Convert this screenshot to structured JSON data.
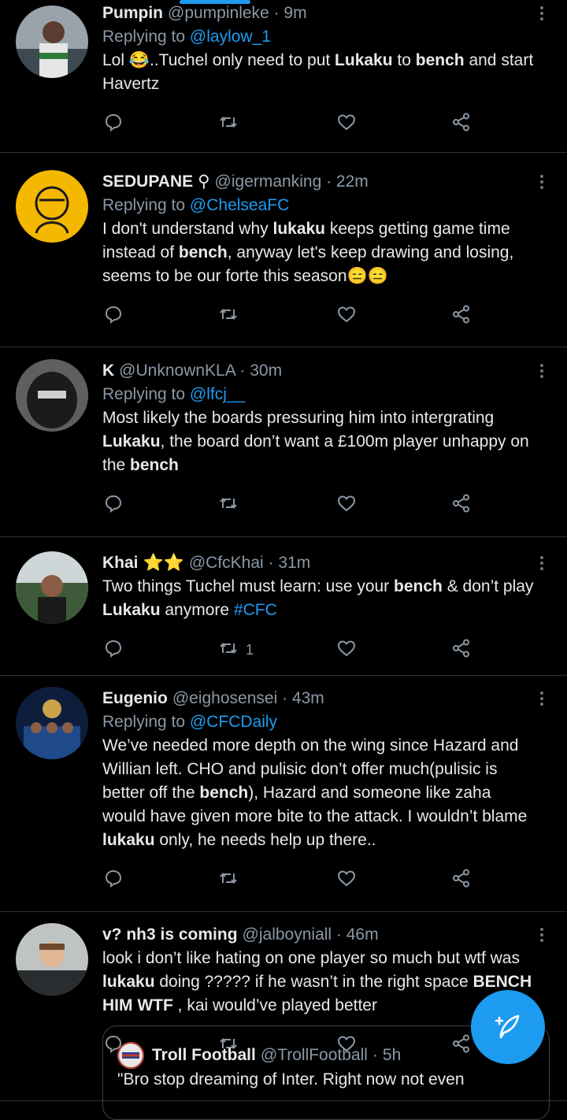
{
  "tweets": [
    {
      "name": "Pumpin",
      "handle": "@pumpinleke",
      "time": "9m",
      "reply_prefix": "Replying to",
      "reply_to": "@laylow_1",
      "text_parts": [
        {
          "t": "Lol 😂..Tuchel only need to put "
        },
        {
          "t": "Lukaku",
          "b": true
        },
        {
          "t": " to "
        },
        {
          "t": "bench",
          "b": true
        },
        {
          "t": " and start Havertz"
        }
      ],
      "retweets": "",
      "avatar_color": "#7a8590"
    },
    {
      "name": "SEDUPANE",
      "badge": "⚲",
      "handle": "@igermanking",
      "time": "22m",
      "reply_prefix": "Replying to",
      "reply_to": "@ChelseaFC",
      "text_parts": [
        {
          "t": "I don't understand why "
        },
        {
          "t": "lukaku",
          "b": true
        },
        {
          "t": " keeps getting game time instead of "
        },
        {
          "t": "bench",
          "b": true
        },
        {
          "t": ", anyway let's keep drawing and losing, seems to be our forte this season😑😑"
        }
      ],
      "retweets": "",
      "avatar_color": "#f5b800"
    },
    {
      "name": "K",
      "handle": "@UnknownKLA",
      "time": "30m",
      "reply_prefix": "Replying to",
      "reply_to": "@lfcj__",
      "text_parts": [
        {
          "t": "Most likely the boards pressuring him into intergrating "
        },
        {
          "t": "Lukaku",
          "b": true
        },
        {
          "t": ", the board don’t want a £100m player unhappy on the "
        },
        {
          "t": "bench",
          "b": true
        }
      ],
      "retweets": "",
      "avatar_color": "#2a2a2a"
    },
    {
      "name": "Khai",
      "badge": "⭐⭐",
      "handle": "@CfcKhai",
      "time": "31m",
      "reply_prefix": "",
      "reply_to": "",
      "text_parts": [
        {
          "t": "Two things Tuchel must learn: use your "
        },
        {
          "t": "bench",
          "b": true
        },
        {
          "t": " & don’t play "
        },
        {
          "t": "Lukaku",
          "b": true
        },
        {
          "t": " anymore "
        },
        {
          "t": "#CFC",
          "tag": true
        }
      ],
      "retweets": "1",
      "avatar_color": "#4a5a48"
    },
    {
      "name": "Eugenio",
      "handle": "@eighosensei",
      "time": "43m",
      "reply_prefix": "Replying to",
      "reply_to": "@CFCDaily",
      "text_parts": [
        {
          "t": "We’ve needed more depth on the wing since Hazard and Willian left. CHO and pulisic don’t offer much(pulisic is better off the "
        },
        {
          "t": "bench",
          "b": true
        },
        {
          "t": "), Hazard and someone like zaha would have given more bite to the attack. I wouldn’t blame "
        },
        {
          "t": "lukaku",
          "b": true
        },
        {
          "t": " only, he needs help up there.."
        }
      ],
      "retweets": "",
      "avatar_color": "#1f4a8a"
    },
    {
      "name": "v? nh3 is coming",
      "handle": "@jalboyniall",
      "time": "46m",
      "reply_prefix": "",
      "reply_to": "",
      "text_parts": [
        {
          "t": "look i don’t like hating on one player so much but wtf was "
        },
        {
          "t": "lukaku",
          "b": true
        },
        {
          "t": " doing ????? if he wasn’t in the right space "
        },
        {
          "t": "BENCH",
          "b": true
        },
        {
          "t": " "
        },
        {
          "t": "HIM WTF",
          "b": true
        },
        {
          "t": " , kai would’ve played better"
        }
      ],
      "retweets": "",
      "avatar_color": "#7d6a5c"
    }
  ],
  "quote": {
    "name": "Troll Football",
    "handle": "@TrollFootball",
    "time": "5h",
    "text": "\"Bro stop dreaming of Inter. Right now not even"
  },
  "colors": {
    "accent": "#1d9bf0",
    "muted": "#8b98a5",
    "background": "#000000"
  },
  "icons": [
    "reply-icon",
    "retweet-icon",
    "like-icon",
    "share-icon",
    "more-icon",
    "compose-tweet-icon"
  ]
}
